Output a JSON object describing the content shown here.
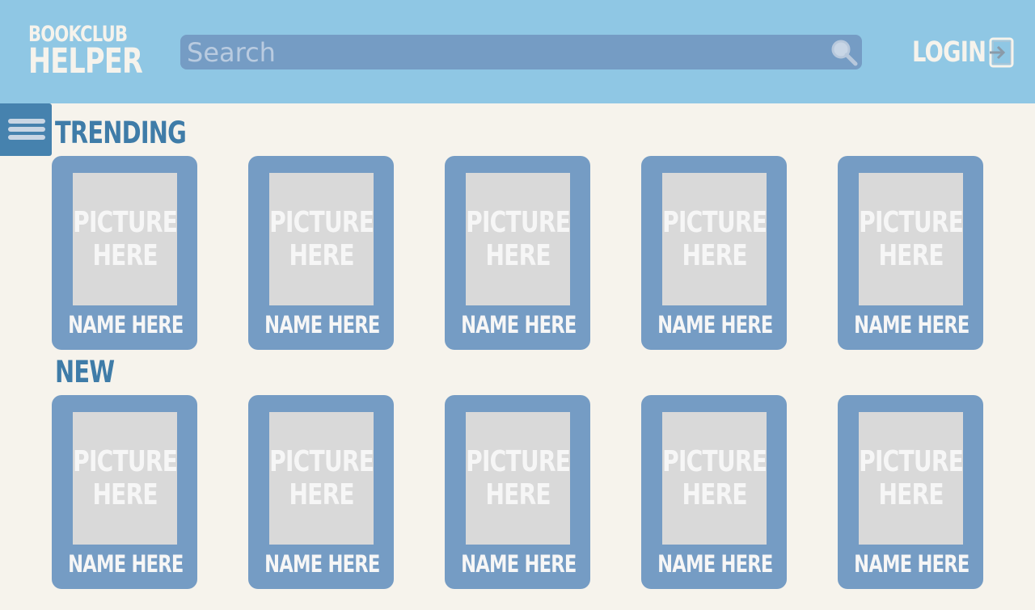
{
  "colors": {
    "header_bg": "#8fc7e4",
    "page_bg": "#f6f3ec",
    "card_bg": "#759cc4",
    "picture_placeholder": "#d9d9d9",
    "section_title": "#3f7ca8",
    "menu_button": "#4682ae"
  },
  "header": {
    "logo_line1": "BOOKCLUB",
    "logo_line2": "HELPER",
    "search_placeholder": "Search",
    "search_icon": "magnifier-icon",
    "login_label": "LOGIN",
    "login_icon": "login-arrow-icon"
  },
  "menu": {
    "icon": "hamburger-menu-icon"
  },
  "sections": [
    {
      "title": "TRENDING",
      "books": [
        {
          "picture": "PICTURE\nHERE",
          "name": "NAME HERE"
        },
        {
          "picture": "PICTURE\nHERE",
          "name": "NAME HERE"
        },
        {
          "picture": "PICTURE\nHERE",
          "name": "NAME HERE"
        },
        {
          "picture": "PICTURE\nHERE",
          "name": "NAME HERE"
        },
        {
          "picture": "PICTURE\nHERE",
          "name": "NAME HERE"
        }
      ]
    },
    {
      "title": "NEW",
      "books": [
        {
          "picture": "PICTURE\nHERE",
          "name": "NAME HERE"
        },
        {
          "picture": "PICTURE\nHERE",
          "name": "NAME HERE"
        },
        {
          "picture": "PICTURE\nHERE",
          "name": "NAME HERE"
        },
        {
          "picture": "PICTURE\nHERE",
          "name": "NAME HERE"
        },
        {
          "picture": "PICTURE\nHERE",
          "name": "NAME HERE"
        }
      ]
    }
  ]
}
